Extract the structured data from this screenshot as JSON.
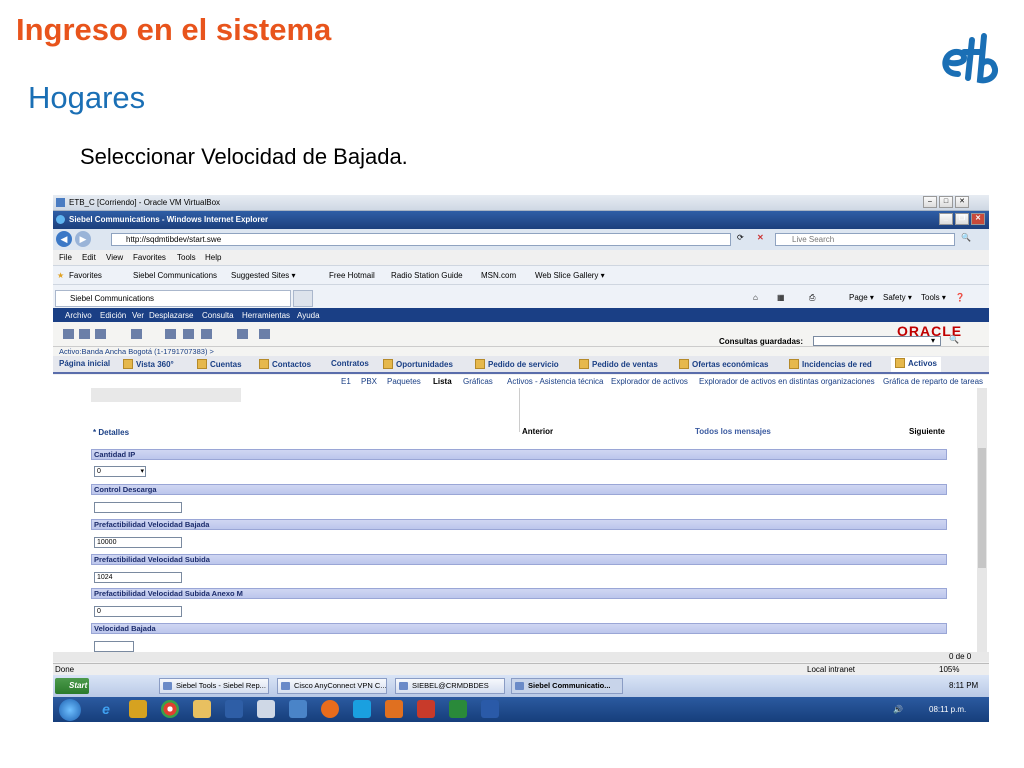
{
  "slide": {
    "title": "Ingreso en el sistema",
    "subtitle": "Hogares",
    "instruction": "Seleccionar Velocidad de Bajada."
  },
  "vbox": {
    "title": "ETB_C [Corriendo] - Oracle VM VirtualBox"
  },
  "ie": {
    "title": "Siebel Communications - Windows Internet Explorer",
    "address": "http://sqdmtibdev/start.swe",
    "search_placeholder": "Live Search",
    "menu": [
      "File",
      "Edit",
      "View",
      "Favorites",
      "Tools",
      "Help"
    ],
    "favorites_label": "Favorites",
    "favorites": [
      "Siebel Communications",
      "Suggested Sites ▾",
      "Free Hotmail",
      "Radio Station Guide",
      "MSN.com",
      "Web Slice Gallery ▾"
    ],
    "tab_label": "Siebel Communications",
    "command_bar": [
      "Page ▾",
      "Safety ▾",
      "Tools ▾"
    ]
  },
  "siebel": {
    "menu": [
      "Archivo",
      "Edición",
      "Ver",
      "Desplazarse",
      "Consulta",
      "Herramientas",
      "Ayuda"
    ],
    "oracle": "ORACLE",
    "saved_queries_label": "Consultas guardadas:",
    "breadcrumb": "Activo:Banda Ancha Bogotá (1-1791707383)  >",
    "tabs": [
      "Página inicial",
      "Vista 360°",
      "Cuentas",
      "Contactos",
      "Contratos",
      "Oportunidades",
      "Pedido de servicio",
      "Pedido de ventas",
      "Ofertas económicas",
      "Incidencias de red",
      "Activos"
    ],
    "subtabs": [
      "E1",
      "PBX",
      "Paquetes",
      "Lista",
      "Gráficas",
      "Activos - Asistencia técnica",
      "Explorador de activos",
      "Explorador de activos en distintas organizaciones",
      "Gráfica de reparto de tareas"
    ],
    "details_label": "* Detalles",
    "nav": {
      "prev": "Anterior",
      "all": "Todos los mensajes",
      "next": "Siguiente"
    },
    "fields": [
      {
        "label": "Cantidad IP",
        "value": "0"
      },
      {
        "label": "Control Descarga",
        "value": ""
      },
      {
        "label": "Prefactibilidad Velocidad Bajada",
        "value": "10000"
      },
      {
        "label": "Prefactibilidad Velocidad Subida",
        "value": "1024"
      },
      {
        "label": "Prefactibilidad Velocidad Subida Anexo M",
        "value": "0"
      },
      {
        "label": "Velocidad Bajada",
        "value": ""
      }
    ],
    "record_count": "0 de 0"
  },
  "status": {
    "left": "Done",
    "zone": "Local intranet",
    "zoom": "105%"
  },
  "xp_taskbar": {
    "start": "Start",
    "items": [
      "Siebel Tools - Siebel Rep...",
      "Cisco AnyConnect VPN C...",
      "SIEBEL@CRMDBDES",
      "Siebel Communicatio..."
    ],
    "clock": "8:11 PM"
  },
  "win7_taskbar": {
    "clock": "08:11 p.m."
  },
  "colors": {
    "title": "#e8541c",
    "subtitle": "#1a6fb5",
    "siebel_blue": "#1a3f85"
  }
}
